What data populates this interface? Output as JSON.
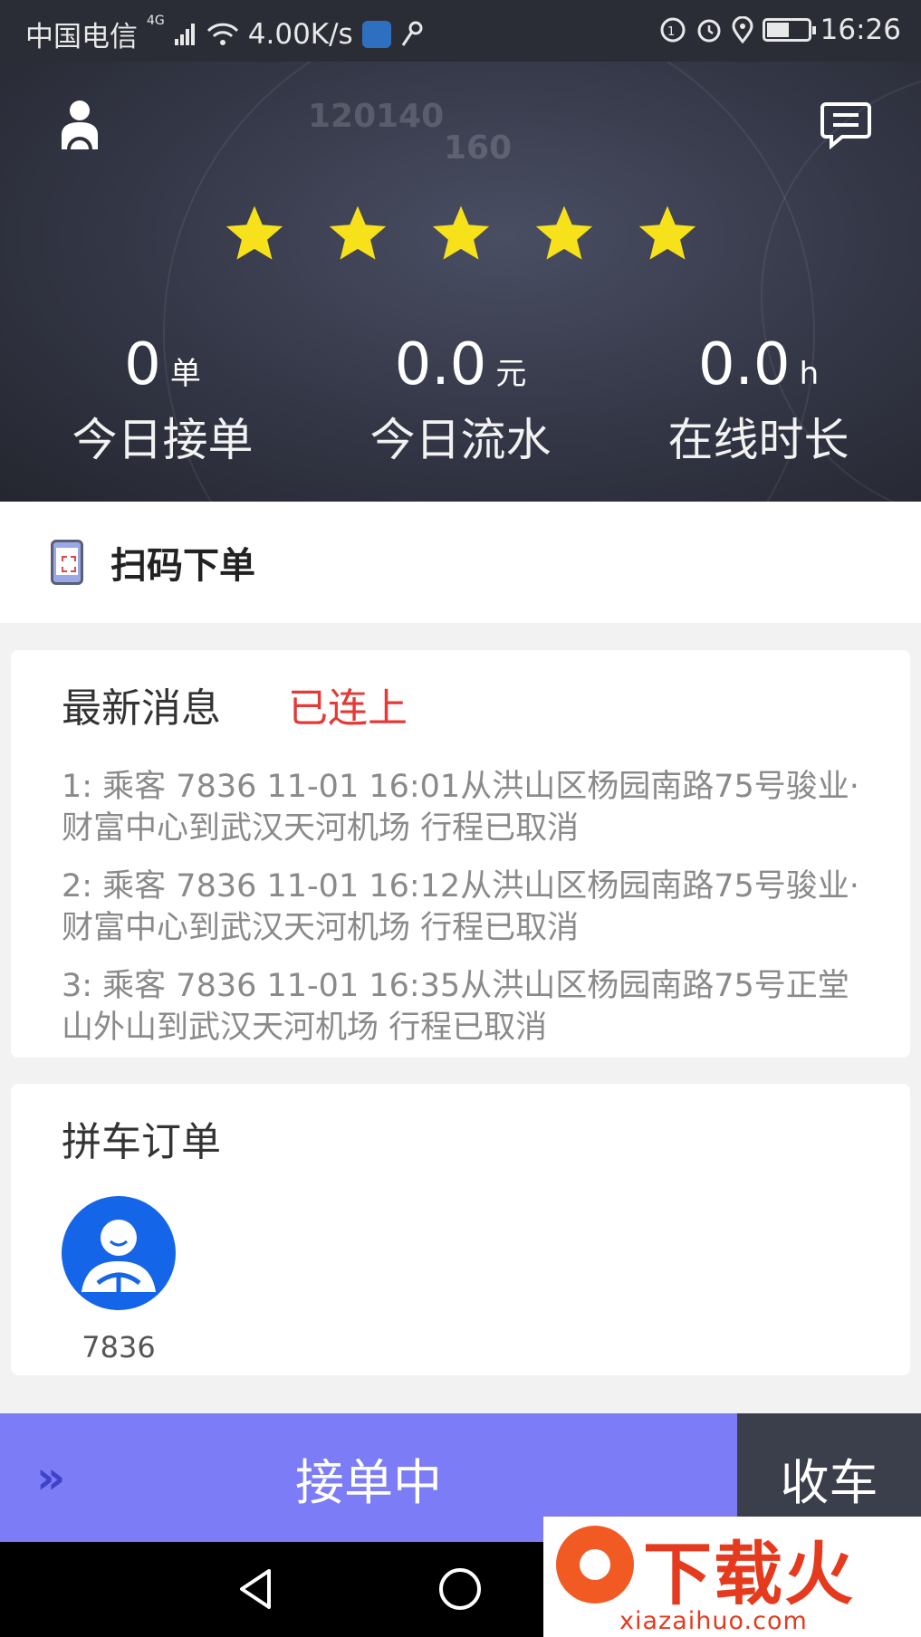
{
  "status_bar": {
    "carrier": "中国电信",
    "network": "4G",
    "speed": "4.00K/s",
    "time": "16:26",
    "battery_level": 0.55
  },
  "header": {
    "profile_icon": "driver-profile-icon",
    "message_icon": "chat-message-icon",
    "rating_stars": 5,
    "dial_numbers": [
      "120",
      "140",
      "160"
    ],
    "stats": [
      {
        "value": "0",
        "unit": "单",
        "label": "今日接单"
      },
      {
        "value": "0.0",
        "unit": "元",
        "label": "今日流水"
      },
      {
        "value": "0.0",
        "unit": "h",
        "label": "在线时长"
      }
    ]
  },
  "scan": {
    "label": "扫码下单",
    "icon": "phone-scan-icon"
  },
  "messages": {
    "title": "最新消息",
    "connection_status": "已连上",
    "connection_color": "#e53935",
    "items": [
      "1: 乘客 7836 11-01 16:01从洪山区杨园南路75号骏业·财富中心到武汉天河机场 行程已取消",
      "2: 乘客 7836 11-01 16:12从洪山区杨园南路75号骏业·财富中心到武汉天河机场 行程已取消",
      "3: 乘客 7836 11-01 16:35从洪山区杨园南路75号正堂山外山到武汉天河机场 行程已取消"
    ]
  },
  "carpool": {
    "title": "拼车订单",
    "passengers": [
      {
        "name": "7836",
        "icon": "passenger-avatar-icon"
      }
    ]
  },
  "bottom": {
    "status_label": "接单中",
    "stop_label": "收车",
    "accent": "#7b7cf6"
  },
  "watermark": {
    "brand": "下载火",
    "url": "xiazaihuo.com"
  }
}
